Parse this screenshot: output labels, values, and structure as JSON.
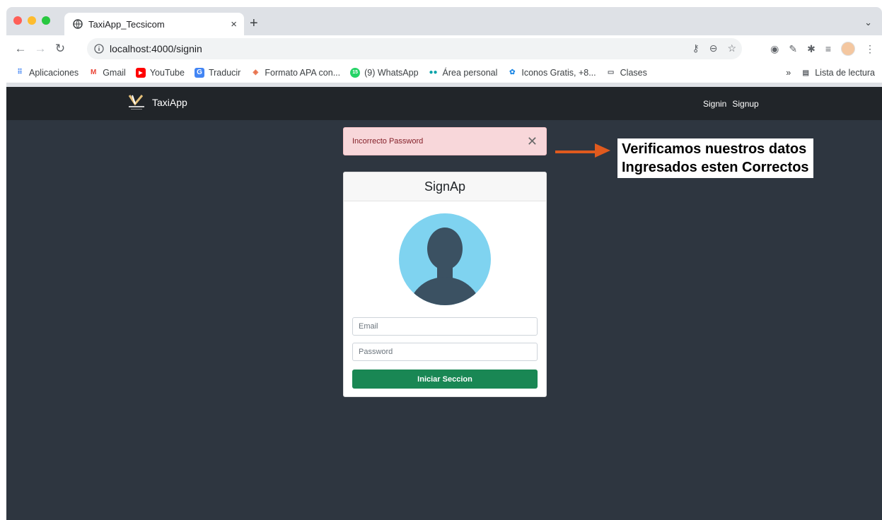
{
  "browser": {
    "tab_title": "TaxiApp_Tecsicom",
    "tab_close": "×",
    "new_tab": "+",
    "tab_menu": "⌄",
    "url": "localhost:4000/signin",
    "bookmarks": [
      {
        "label": "Aplicaciones",
        "icon": "apps-grid-icon"
      },
      {
        "label": "Gmail",
        "icon": "gmail-icon"
      },
      {
        "label": "YouTube",
        "icon": "youtube-icon"
      },
      {
        "label": "Traducir",
        "icon": "translate-icon"
      },
      {
        "label": "Formato APA con...",
        "icon": "apa-icon"
      },
      {
        "label": "(9) WhatsApp",
        "icon": "whatsapp-icon"
      },
      {
        "label": "Área personal",
        "icon": "dots-icon"
      },
      {
        "label": "Iconos Gratis, +8...",
        "icon": "icons-icon"
      },
      {
        "label": "Clases",
        "icon": "folder-icon"
      }
    ],
    "bookmarks_more": "»",
    "reading_list": "Lista de lectura"
  },
  "app": {
    "brand": "TaxiApp",
    "nav": {
      "signin": "Signin",
      "signup": "Signup"
    },
    "alert": "Incorrecto Password",
    "alert_close": "✕",
    "card_title": "SignAp",
    "email_placeholder": "Email",
    "password_placeholder": "Password",
    "submit": "Iniciar Seccion"
  },
  "annotation": {
    "line1": "Verificamos nuestros datos",
    "line2": "Ingresados esten Correctos",
    "arrow_color": "#e05a1e"
  },
  "colors": {
    "page_bg": "#2e3640",
    "navbar": "#212529",
    "alert_bg": "#f8d7da",
    "button": "#198754",
    "avatar_circle": "#7fd3f0",
    "avatar_figure": "#3b5162"
  }
}
